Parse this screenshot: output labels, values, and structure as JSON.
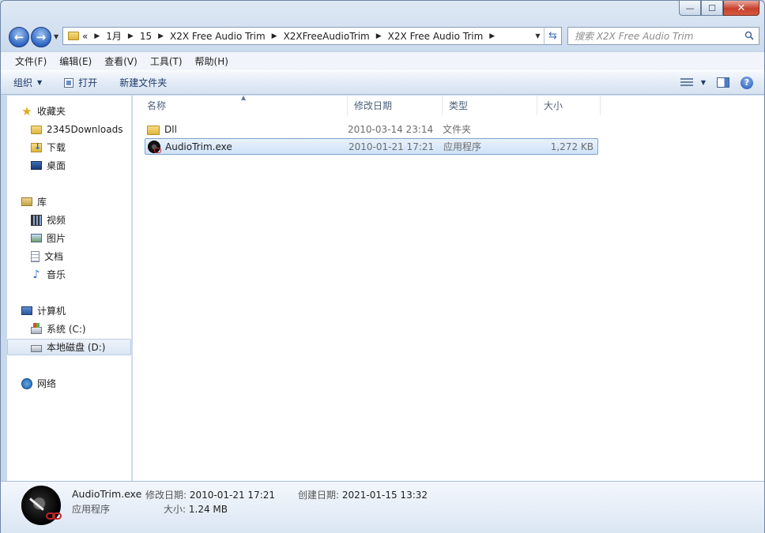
{
  "address": {
    "overflow": "«",
    "segments": [
      "1月",
      "15",
      "X2X Free Audio Trim",
      "X2XFreeAudioTrim",
      "X2X Free Audio Trim"
    ]
  },
  "search": {
    "placeholder": "搜索 X2X Free Audio Trim"
  },
  "menu": [
    "文件(F)",
    "编辑(E)",
    "查看(V)",
    "工具(T)",
    "帮助(H)"
  ],
  "toolbar": {
    "organize": "组织",
    "open": "打开",
    "new_folder": "新建文件夹"
  },
  "window_buttons": {
    "minimize": "—",
    "maximize": "☐",
    "close": "✕"
  },
  "nav": {
    "favorites": {
      "label": "收藏夹",
      "items": [
        "2345Downloads",
        "下载",
        "桌面"
      ]
    },
    "libraries": {
      "label": "库",
      "items": [
        "视频",
        "图片",
        "文档",
        "音乐"
      ]
    },
    "computer": {
      "label": "计算机",
      "items": [
        "系统 (C:)",
        "本地磁盘 (D:)"
      ]
    },
    "network": {
      "label": "网络"
    }
  },
  "columns": [
    "名称",
    "修改日期",
    "类型",
    "大小"
  ],
  "files": [
    {
      "name": "Dll",
      "date": "2010-03-14 23:14",
      "type": "文件夹",
      "size": "",
      "icon": "folder-icon"
    },
    {
      "name": "AudioTrim.exe",
      "date": "2010-01-21 17:21",
      "type": "应用程序",
      "size": "1,272 KB",
      "icon": "app-icon"
    }
  ],
  "details": {
    "name": "AudioTrim.exe",
    "type": "应用程序",
    "modified_label": "修改日期:",
    "modified": "2010-01-21 17:21",
    "created_label": "创建日期:",
    "created": "2021-01-15 13:32",
    "size_label": "大小:",
    "size": "1.24 MB"
  }
}
